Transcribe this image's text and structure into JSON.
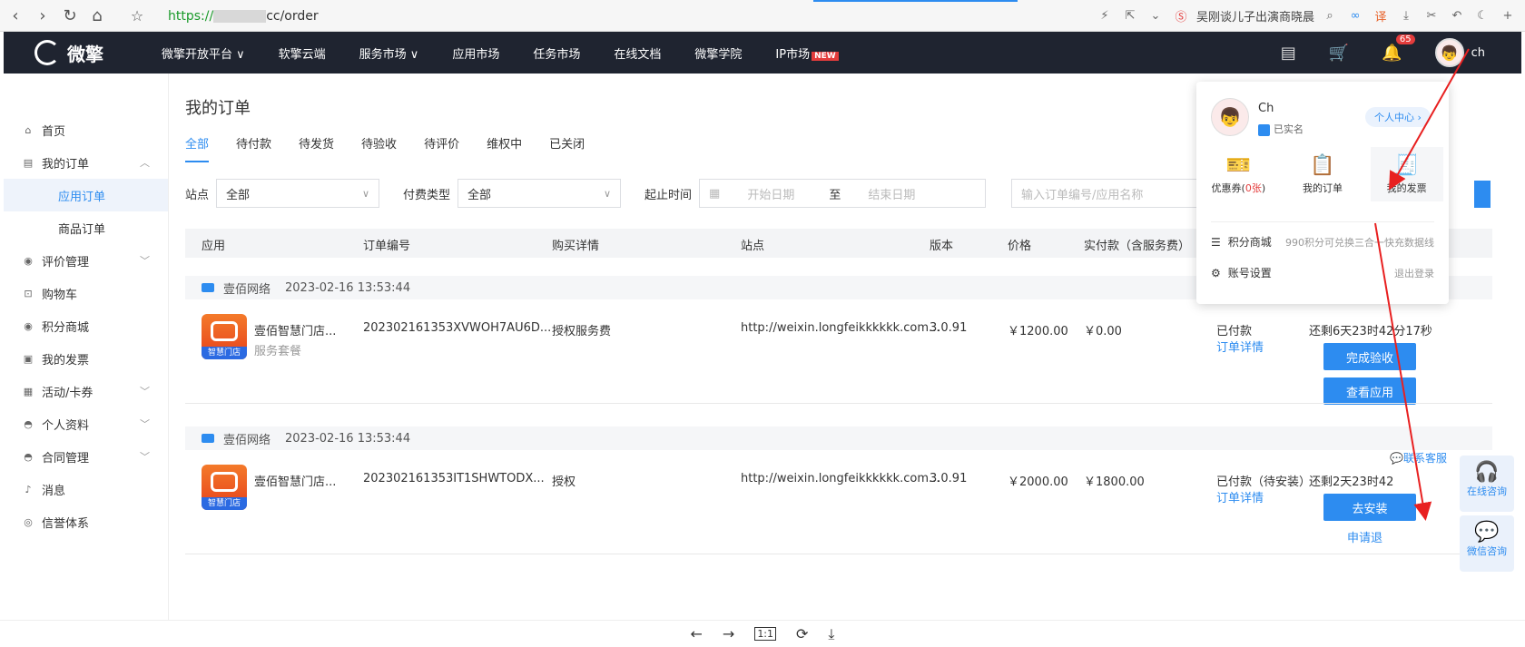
{
  "browser": {
    "url_prefix": "https://",
    "url_suffix": "cc/order",
    "news_text": "吴刚谈儿子出演商晓晨"
  },
  "topbar": {
    "logo_text": "微擎",
    "nav": [
      "微擎开放平台 ∨",
      "软擎云端",
      "服务市场 ∨",
      "应用市场",
      "任务市场",
      "在线文档",
      "微擎学院",
      "IP市场"
    ],
    "new_badge": "NEW",
    "notify_count": "65",
    "username": "ch"
  },
  "sidebar": {
    "items": [
      {
        "icon": "⌂",
        "label": "首页"
      },
      {
        "icon": "▤",
        "label": "我的订单",
        "arrow": "︿"
      },
      {
        "label": "应用订单",
        "sub": true,
        "active": true
      },
      {
        "label": "商品订单",
        "sub": true
      },
      {
        "icon": "◉",
        "label": "评价管理",
        "arrow": "﹀"
      },
      {
        "icon": "⊡",
        "label": "购物车"
      },
      {
        "icon": "◉",
        "label": "积分商城"
      },
      {
        "icon": "▣",
        "label": "我的发票"
      },
      {
        "icon": "▦",
        "label": "活动/卡券",
        "arrow": "﹀"
      },
      {
        "icon": "◓",
        "label": "个人资料",
        "arrow": "﹀"
      },
      {
        "icon": "◓",
        "label": "合同管理",
        "arrow": "﹀"
      },
      {
        "icon": "♪",
        "label": "消息"
      },
      {
        "icon": "◎",
        "label": "信誉体系"
      }
    ]
  },
  "main": {
    "title": "我的订单",
    "tabs": [
      "全部",
      "待付款",
      "待发货",
      "待验收",
      "待评价",
      "维权中",
      "已关闭"
    ],
    "filter": {
      "site_label": "站点",
      "site_value": "全部",
      "pay_label": "付费类型",
      "pay_value": "全部",
      "time_label": "起止时间",
      "start_placeholder": "开始日期",
      "to": "至",
      "end_placeholder": "结束日期",
      "search_placeholder": "输入订单编号/应用名称"
    },
    "columns": [
      "应用",
      "订单编号",
      "购买详情",
      "站点",
      "版本",
      "价格",
      "实付款（含服务费）"
    ],
    "orders": [
      {
        "shop": "壹佰网络",
        "time": "2023-02-16 13:53:44",
        "app_name": "壹佰智慧门店...",
        "app_sub": "服务套餐",
        "app_badge": "智慧门店3.0",
        "order_no": "202302161353XVWOH7AU6D...",
        "detail": "授权服务费",
        "site": "http://weixin.longfeikkkkkk.com...",
        "version": "3.0.91",
        "price": "￥1200.00",
        "paid": "￥0.00",
        "status": "已付款",
        "status_link": "订单详情",
        "countdown": "还剩6天23时42分17秒",
        "btn1": "完成验收",
        "btn2": "查看应用"
      },
      {
        "shop": "壹佰网络",
        "time": "2023-02-16 13:53:44",
        "app_name": "壹佰智慧门店...",
        "app_sub": "",
        "app_badge": "智慧门店3.0",
        "order_no": "202302161353IT1SHWTODX...",
        "detail": "授权",
        "site": "http://weixin.longfeikkkkkk.com...",
        "version": "3.0.91",
        "price": "￥2000.00",
        "paid": "￥1800.00",
        "status": "已付款（待安装）",
        "status_link": "订单详情",
        "countdown": "还剩2天23时42",
        "btn1": "去安装",
        "btn2_link": "申请退",
        "contact": "联系客服"
      }
    ]
  },
  "popup": {
    "name": "Ch",
    "verified": "已实名",
    "center": "个人中心 ›",
    "grid": [
      {
        "icon": "🎫",
        "label": "优惠券(",
        "count": "0张",
        "tail": ")"
      },
      {
        "icon": "📋",
        "label": "我的订单"
      },
      {
        "icon": "🧾",
        "label": "我的发票"
      }
    ],
    "points_label": "积分商城",
    "points_tip": "990积分可兑换三合一快充数据线",
    "account_label": "账号设置",
    "logout": "退出登录"
  },
  "float": {
    "online": "在线咨询",
    "wechat": "微信咨询"
  }
}
